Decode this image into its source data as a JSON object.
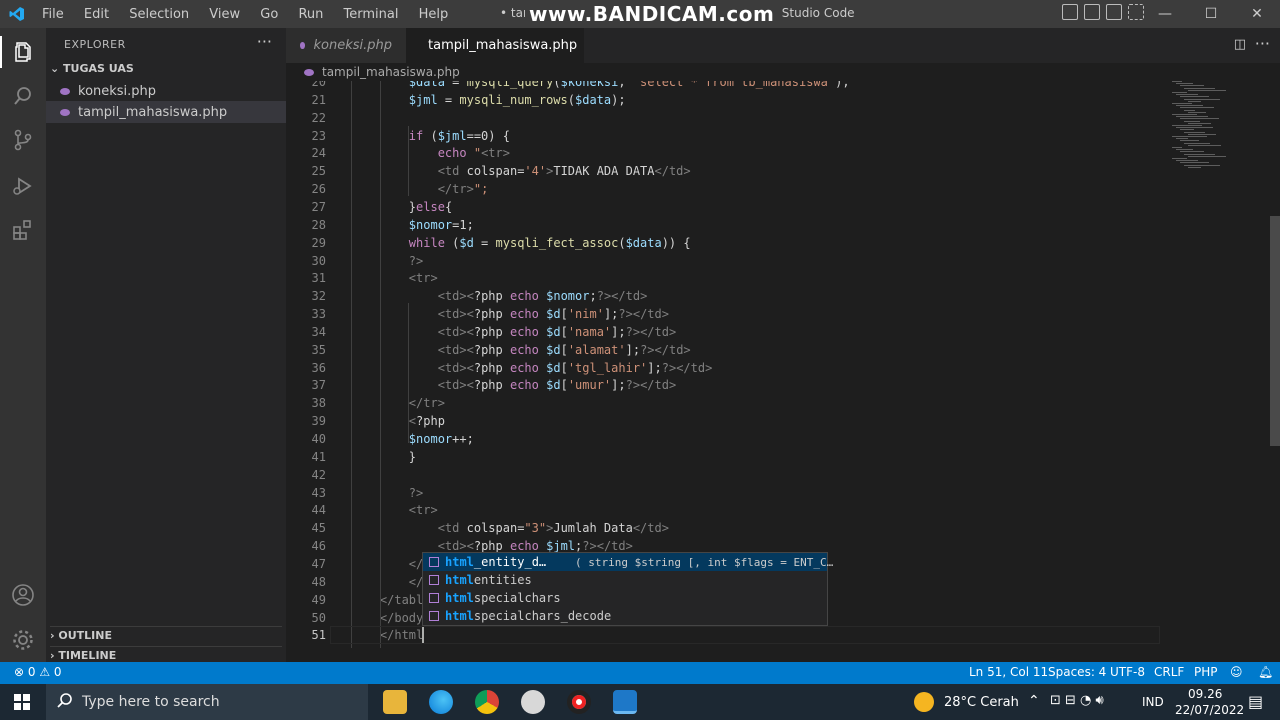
{
  "titlebar": {
    "menu": [
      "File",
      "Edit",
      "Selection",
      "View",
      "Go",
      "Run",
      "Terminal",
      "Help"
    ],
    "title": "• tampil_mahasiswa.php - TUGAS UAS - Visual Studio Code",
    "watermark": "www.BANDICAM.com",
    "controls": {
      "minimize": "—",
      "maximize": "☐",
      "close": "✕"
    }
  },
  "sidebar": {
    "header": "EXPLORER",
    "more": "···",
    "folder": "TUGAS UAS",
    "files": [
      "koneksi.php",
      "tampil_mahasiswa.php"
    ],
    "sections": [
      "OUTLINE",
      "TIMELINE"
    ]
  },
  "tabs": [
    {
      "label": "koneksi.php"
    },
    {
      "label": "tampil_mahasiswa.php"
    }
  ],
  "breadcrumb": "tampil_mahasiswa.php",
  "editor": {
    "lines": [
      {
        "n": "20",
        "t": "        $data = mysqli_query($koneksi, \"select * from tb_mahasiswa\");"
      },
      {
        "n": "21",
        "t": "        $jml = mysqli_num_rows($data);"
      },
      {
        "n": "22",
        "t": ""
      },
      {
        "n": "23",
        "t": "        if ($jml==0) {"
      },
      {
        "n": "24",
        "t": "            echo \"<tr>"
      },
      {
        "n": "25",
        "t": "            <td colspan='4'>TIDAK ADA DATA</td>"
      },
      {
        "n": "26",
        "t": "            </tr>\";"
      },
      {
        "n": "27",
        "t": "        }else{"
      },
      {
        "n": "28",
        "t": "        $nomor=1;"
      },
      {
        "n": "29",
        "t": "        while ($d = mysqli_fect_assoc($data)) {"
      },
      {
        "n": "30",
        "t": "        ?>"
      },
      {
        "n": "31",
        "t": "        <tr>"
      },
      {
        "n": "32",
        "t": "            <td><?php echo $nomor;?></td>"
      },
      {
        "n": "33",
        "t": "            <td><?php echo $d['nim'];?></td>"
      },
      {
        "n": "34",
        "t": "            <td><?php echo $d['nama'];?></td>"
      },
      {
        "n": "35",
        "t": "            <td><?php echo $d['alamat'];?></td>"
      },
      {
        "n": "36",
        "t": "            <td><?php echo $d['tgl_lahir'];?></td>"
      },
      {
        "n": "37",
        "t": "            <td><?php echo $d['umur'];?></td>"
      },
      {
        "n": "38",
        "t": "        </tr>"
      },
      {
        "n": "39",
        "t": "        <?php"
      },
      {
        "n": "40",
        "t": "        $nomor++;"
      },
      {
        "n": "41",
        "t": "        }"
      },
      {
        "n": "42",
        "t": ""
      },
      {
        "n": "43",
        "t": "        ?>"
      },
      {
        "n": "44",
        "t": "        <tr>"
      },
      {
        "n": "45",
        "t": "            <td colspan=\"3\">Jumlah Data</td>"
      },
      {
        "n": "46",
        "t": "            <td><?php echo $jml;?></td>"
      },
      {
        "n": "47",
        "t": "        </"
      },
      {
        "n": "48",
        "t": "        </"
      },
      {
        "n": "49",
        "t": "    </tabl"
      },
      {
        "n": "50",
        "t": "    </body"
      },
      {
        "n": "51",
        "t": "    </html"
      }
    ]
  },
  "suggest": {
    "items": [
      {
        "match": "html",
        "rest": "_entity_d…",
        "detail": "( string $string [, int $flags = ENT_C…"
      },
      {
        "match": "html",
        "rest": "entities",
        "detail": ""
      },
      {
        "match": "html",
        "rest": "specialchars",
        "detail": ""
      },
      {
        "match": "html",
        "rest": "specialchars_decode",
        "detail": ""
      }
    ]
  },
  "statusbar": {
    "problems": "⊗ 0 ⚠ 0",
    "position": "Ln 51, Col 11",
    "spaces": "Spaces: 4",
    "encoding": "UTF-8",
    "eol": "CRLF",
    "language": "PHP"
  },
  "taskbar": {
    "search_placeholder": "Type here to search",
    "weather": "28°C  Cerah",
    "lang": "IND",
    "time": "09.26",
    "date": "22/07/2022"
  },
  "colors": {
    "accent": "#007acc",
    "keyword": "#c586c0",
    "variable": "#9cdcfe",
    "string": "#ce9178",
    "tag": "#808080"
  }
}
